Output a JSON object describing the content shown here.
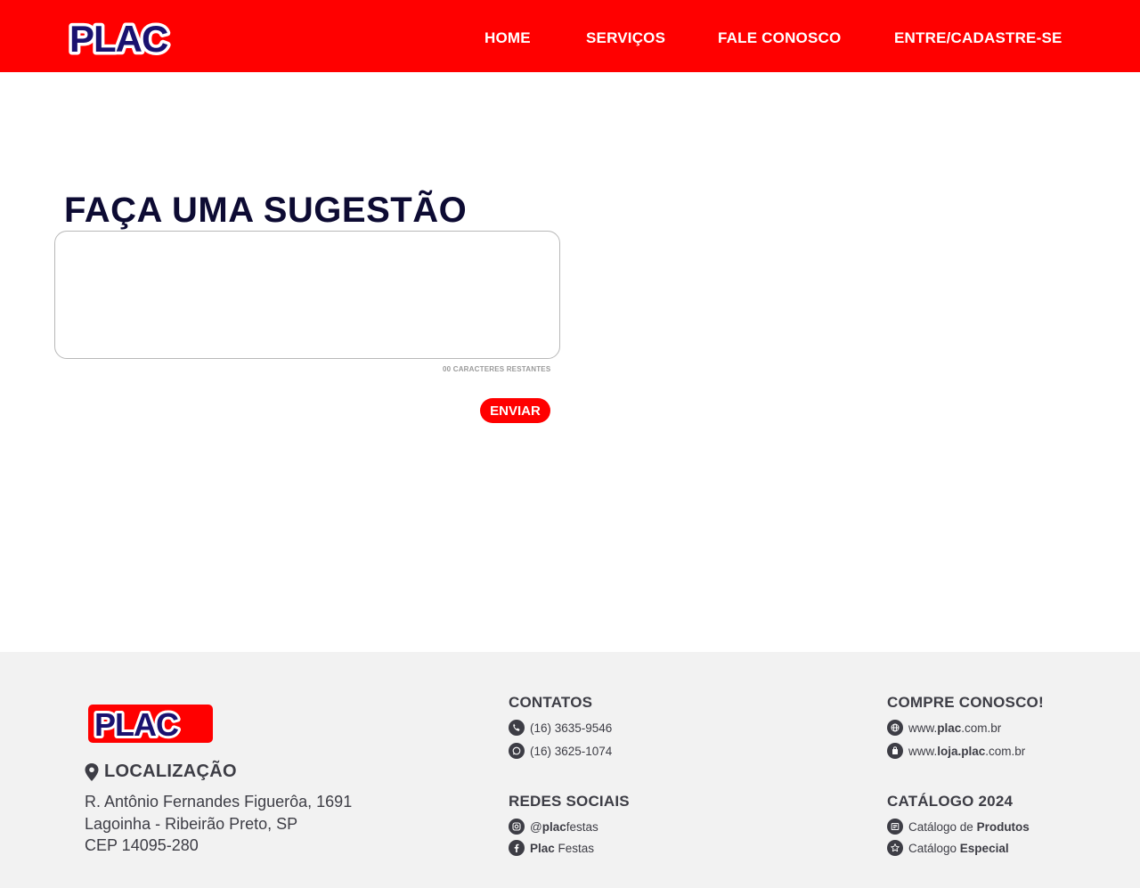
{
  "header": {
    "logo_text": "PLAC",
    "nav": [
      "HOME",
      "SERVIÇOS",
      "FALE CONOSCO",
      "ENTRE/CADASTRE-SE"
    ]
  },
  "main": {
    "title": "FAÇA UMA SUGESTÃO",
    "textarea_value": "",
    "counter": "00 CARACTERES RESTANTES",
    "send_label": "ENVIAR"
  },
  "footer": {
    "logo_text": "PLAC",
    "location": {
      "title": "LOCALIZAÇÃO",
      "lines": [
        "R. Antônio Fernandes Figuerôa, 1691",
        "Lagoinha - Ribeirão Preto, SP",
        "CEP 14095-280"
      ]
    },
    "contacts": {
      "title": "CONTATOS",
      "phone": "(16) 3635-9546",
      "whatsapp": "(16) 3625-1074"
    },
    "social": {
      "title": "REDES SOCIAIS",
      "instagram": {
        "prefix": "@",
        "bold": "plac",
        "suffix": "festas"
      },
      "facebook": {
        "bold": "Plac",
        "suffix": " Festas"
      }
    },
    "shop": {
      "title": "COMPRE CONOSCO!",
      "site1": {
        "prefix": "www.",
        "bold": "plac",
        "suffix": ".com.br"
      },
      "site2": {
        "prefix": "www.",
        "bold": "loja.plac",
        "suffix": ".com.br"
      }
    },
    "catalog": {
      "title": "CATÁLOGO 2024",
      "item1": {
        "prefix": "Catálogo de ",
        "bold": "Produtos"
      },
      "item2": {
        "prefix": "Catálogo ",
        "bold": "Especial"
      }
    }
  },
  "colors": {
    "brand_red": "#ff0000",
    "brand_navy": "#0d0b33",
    "footer_bg": "#f2f2f2",
    "text_gray": "#3d3d45"
  }
}
